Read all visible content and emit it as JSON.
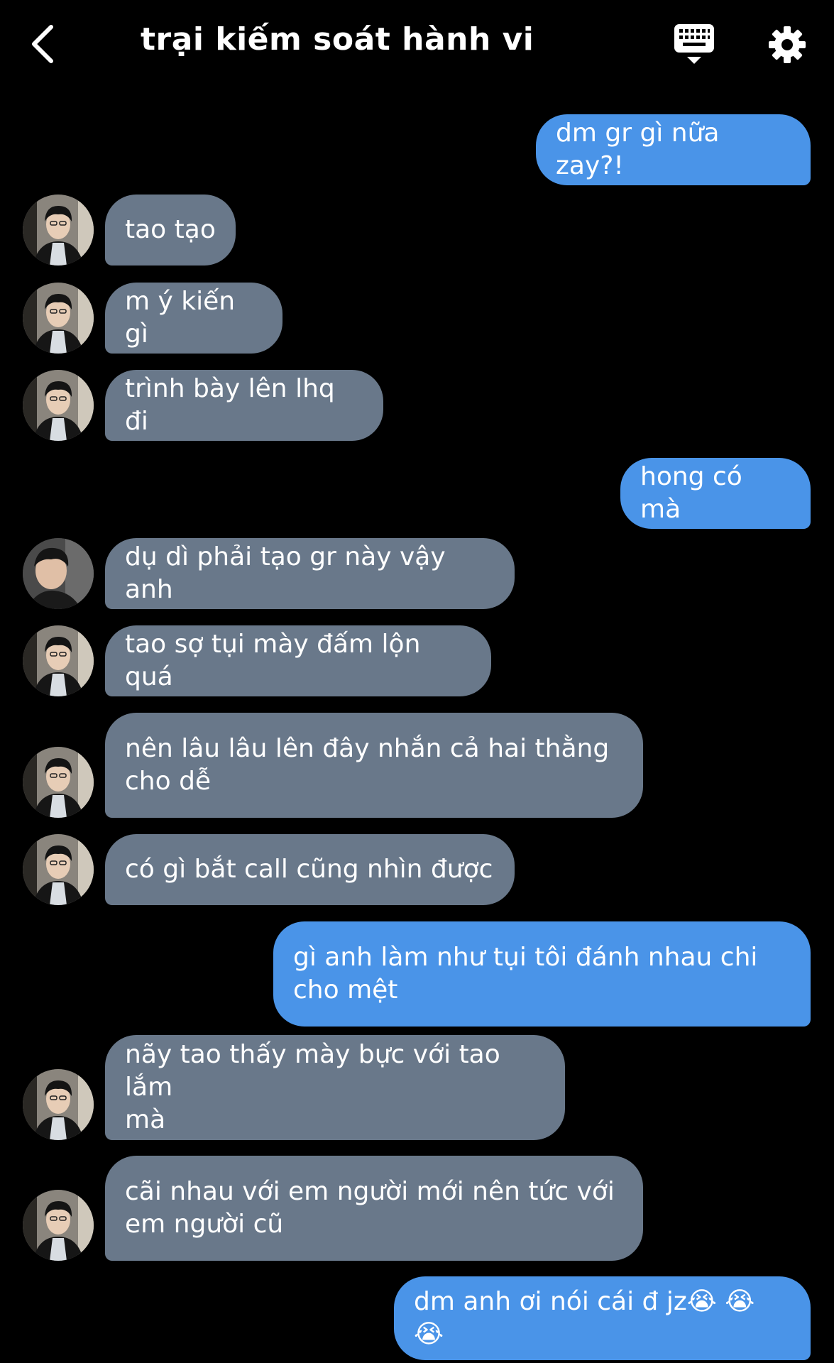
{
  "header": {
    "title": "trại kiếm soát hành vi",
    "icons": [
      "back-chevron-icon",
      "keyboard-icon",
      "gear-icon"
    ]
  },
  "messages": [
    {
      "side": "out",
      "text": "dm gr gì nữa zay?!"
    },
    {
      "side": "in",
      "avatar": "a",
      "text": "tao tạo"
    },
    {
      "side": "in",
      "avatar": "a",
      "text": "m ý kiến gì"
    },
    {
      "side": "in",
      "avatar": "a",
      "text": "trình bày lên lhq đi"
    },
    {
      "side": "out",
      "text": "hong có mà"
    },
    {
      "side": "in",
      "avatar": "b",
      "text": "dụ dì phải tạo gr này vậy anh"
    },
    {
      "side": "in",
      "avatar": "a",
      "text": "tao sợ tụi mày đấm lộn quá"
    },
    {
      "side": "in",
      "avatar": "a",
      "text": "nên lâu lâu lên đây nhắn cả hai thằng\ncho dễ"
    },
    {
      "side": "in",
      "avatar": "a",
      "text": "có gì bắt call cũng nhìn được"
    },
    {
      "side": "out",
      "text": "gì anh làm như tụi tôi đánh nhau chi\ncho mệt"
    },
    {
      "side": "in",
      "avatar": "a",
      "text": "nãy tao thấy mày bực với tao lắm\nmà"
    },
    {
      "side": "in",
      "avatar": "a",
      "text": "cãi nhau với em người mới nên tức với\nem người cũ"
    },
    {
      "side": "out",
      "text": "dm anh ơi nói cái đ jz😭 😭 😭"
    }
  ]
}
